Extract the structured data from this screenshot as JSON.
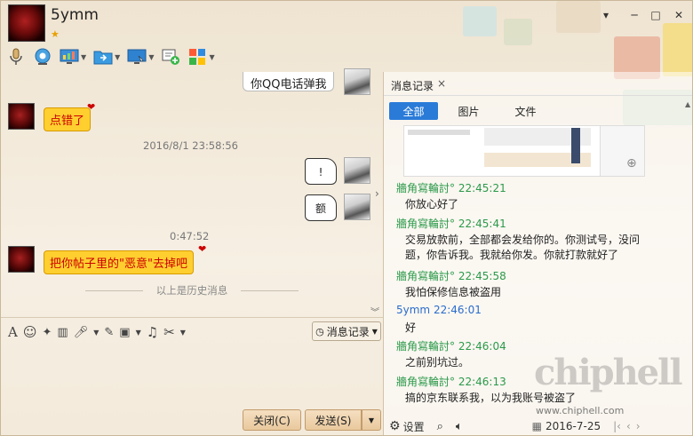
{
  "window": {
    "name": "5ymm",
    "star": "★",
    "controls": [
      "▾",
      "─",
      "□",
      "✕"
    ]
  },
  "toolbar": {
    "icons": [
      "microphone-icon",
      "webcam-icon",
      "screen-share-icon",
      "send-file-icon",
      "remote-assist-icon",
      "invite-icon",
      "apps-icon"
    ]
  },
  "chat": {
    "top_bubble": "你QQ电话弹我",
    "msg1": "点错了",
    "ts1": "2016/8/1 23:58:56",
    "ghost1": "!",
    "ghost2": "额",
    "ts2": "0:47:52",
    "msg2": "把你帖子里的\"恶意\"去掉吧",
    "history_divider": "以上是历史消息"
  },
  "input_toolbar": {
    "history_button": "消息记录",
    "close_button": "关闭(C)",
    "send_button": "发送(S)"
  },
  "history_panel": {
    "tab": "消息记录",
    "close": "×",
    "segments": [
      "全部",
      "图片",
      "文件"
    ],
    "messages": [
      {
        "sender": "牆角寫輪討°",
        "time": "22:45:21",
        "text": "你放心好了",
        "green": true
      },
      {
        "sender": "牆角寫輪討°",
        "time": "22:45:41",
        "text": "交易放款前，全部都会发给你的。你测试号，没问题，你告诉我。我就给你发。你就打款就好了",
        "green": true
      },
      {
        "sender": "牆角寫輪討°",
        "time": "22:45:58",
        "text": "我怕保修信息被盗用",
        "green": true
      },
      {
        "sender": "5ymm",
        "time": "22:46:01",
        "text": "好",
        "green": false
      },
      {
        "sender": "牆角寫輪討°",
        "time": "22:46:04",
        "text": "之前别坑过。",
        "green": true
      },
      {
        "sender": "牆角寫輪討°",
        "time": "22:46:13",
        "text": "搞的京东联系我，以为我账号被盗了",
        "green": true
      }
    ],
    "settings": "设置",
    "date": "2016-7-25"
  },
  "watermark": {
    "big": "chiphell",
    "url": "www.chiphell.com"
  },
  "colors": {
    "accent": "#2a7bd8",
    "green": "#2b9a4a",
    "bubble_yellow": "#ffcf30"
  }
}
